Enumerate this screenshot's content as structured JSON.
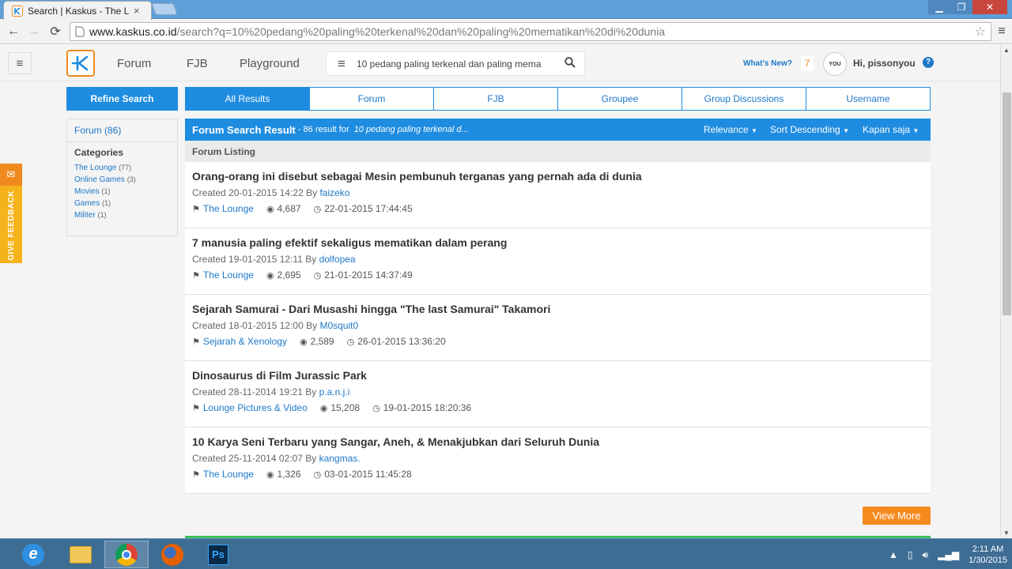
{
  "browser": {
    "tab_title": "Search | Kaskus - The Larg",
    "url_host": "www.kaskus.co.id",
    "url_path": "/search?q=10%20pedang%20paling%20terkenal%20dan%20paling%20mematikan%20di%20dunia"
  },
  "header": {
    "nav": [
      "Forum",
      "FJB",
      "Playground"
    ],
    "search_query": "10 pedang paling terkenal dan paling mema",
    "whats_new": "What's New?",
    "notif_count": "7",
    "greeting": "Hi, pissonyou",
    "avatar_text": "YOU",
    "help": "?"
  },
  "feedback": {
    "label": "GIVE FEEDBACK"
  },
  "sidebar": {
    "refine_label": "Refine Search",
    "forum_count": "Forum (86)",
    "categories_title": "Categories",
    "categories": [
      {
        "name": "The Lounge",
        "count": "(77)"
      },
      {
        "name": "Online Games",
        "count": "(3)"
      },
      {
        "name": "Movies",
        "count": "(1)"
      },
      {
        "name": "Games",
        "count": "(1)"
      },
      {
        "name": "Militer",
        "count": "(1)"
      }
    ]
  },
  "tabs": [
    "All Results",
    "Forum",
    "FJB",
    "Groupee",
    "Group Discussions",
    "Username"
  ],
  "result_header": {
    "title": "Forum Search Result",
    "summary": " - 86 result for ",
    "query": "10 pedang paling terkenal d...",
    "relevance": "Relevance",
    "sort": "Sort Descending",
    "time": "Kapan saja"
  },
  "listing_label": "Forum Listing",
  "results": [
    {
      "title": "Orang-orang ini disebut sebagai Mesin pembunuh terganas yang pernah ada di dunia",
      "created": "Created 20-01-2015 14:22 By ",
      "author": "faizeko",
      "category": "The Lounge",
      "views": "4,687",
      "last": "22-01-2015 17:44:45"
    },
    {
      "title": "7 manusia paling efektif sekaligus mematikan dalam perang",
      "created": "Created 19-01-2015 12:11 By ",
      "author": "dolfopea",
      "category": "The Lounge",
      "views": "2,695",
      "last": "21-01-2015 14:37:49"
    },
    {
      "title": "Sejarah Samurai - Dari Musashi hingga \"The last Samurai\" Takamori",
      "created": "Created 18-01-2015 12:00 By ",
      "author": "M0squit0",
      "category": "Sejarah & Xenology",
      "views": "2,589",
      "last": "26-01-2015 13:36:20"
    },
    {
      "title": "Dinosaurus di Film Jurassic Park",
      "created": "Created 28-11-2014 19:21 By ",
      "author": "p.a.n.j.i",
      "category": "Lounge Pictures & Video",
      "views": "15,208",
      "last": "19-01-2015 18:20:36"
    },
    {
      "title": "10 Karya Seni Terbaru yang Sangar, Aneh, & Menakjubkan dari Seluruh Dunia",
      "created": "Created 25-11-2014 02:07 By ",
      "author": "kangmas.",
      "category": "The Lounge",
      "views": "1,326",
      "last": "03-01-2015 11:45:28"
    }
  ],
  "view_more": "View More",
  "taskbar": {
    "ps_label": "Ps",
    "time": "2:11 AM",
    "date": "1/30/2015"
  },
  "colors": {
    "brand_blue": "#1e8ce0",
    "brand_orange": "#f08a1e",
    "feedback": "#f5b21b"
  }
}
